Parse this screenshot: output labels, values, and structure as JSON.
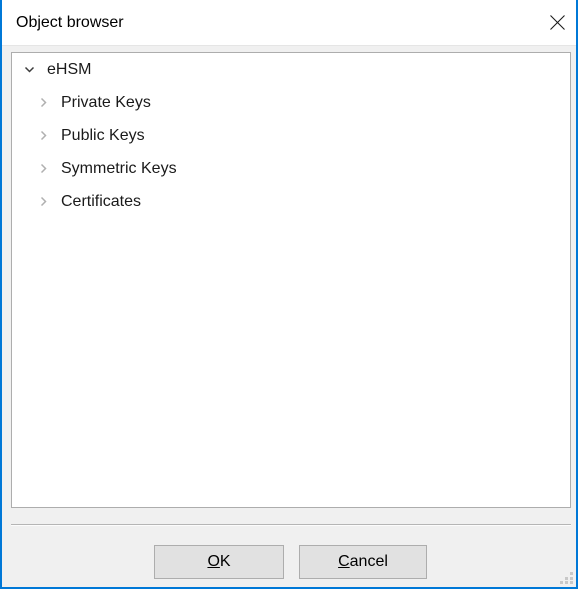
{
  "window": {
    "title": "Object browser",
    "close_icon": "close-icon",
    "accent_color": "#0078d7",
    "titlebar_bg": "#ffffff",
    "body_bg": "#f0f0f0"
  },
  "tree": {
    "background": "#ffffff",
    "border_color": "#adadad",
    "items": [
      {
        "label": "eHSM",
        "level": 0,
        "expanded": true,
        "chevron": "chevron-down-icon"
      },
      {
        "label": "Private Keys",
        "level": 1,
        "expanded": false,
        "chevron": "chevron-right-icon"
      },
      {
        "label": "Public Keys",
        "level": 1,
        "expanded": false,
        "chevron": "chevron-right-icon"
      },
      {
        "label": "Symmetric Keys",
        "level": 1,
        "expanded": false,
        "chevron": "chevron-right-icon"
      },
      {
        "label": "Certificates",
        "level": 1,
        "expanded": false,
        "chevron": "chevron-right-icon"
      }
    ]
  },
  "footer": {
    "ok": {
      "accel": "O",
      "rest": "K"
    },
    "cancel": {
      "accel": "C",
      "rest": "ancel"
    }
  },
  "resize_grip": "resize-grip-icon"
}
